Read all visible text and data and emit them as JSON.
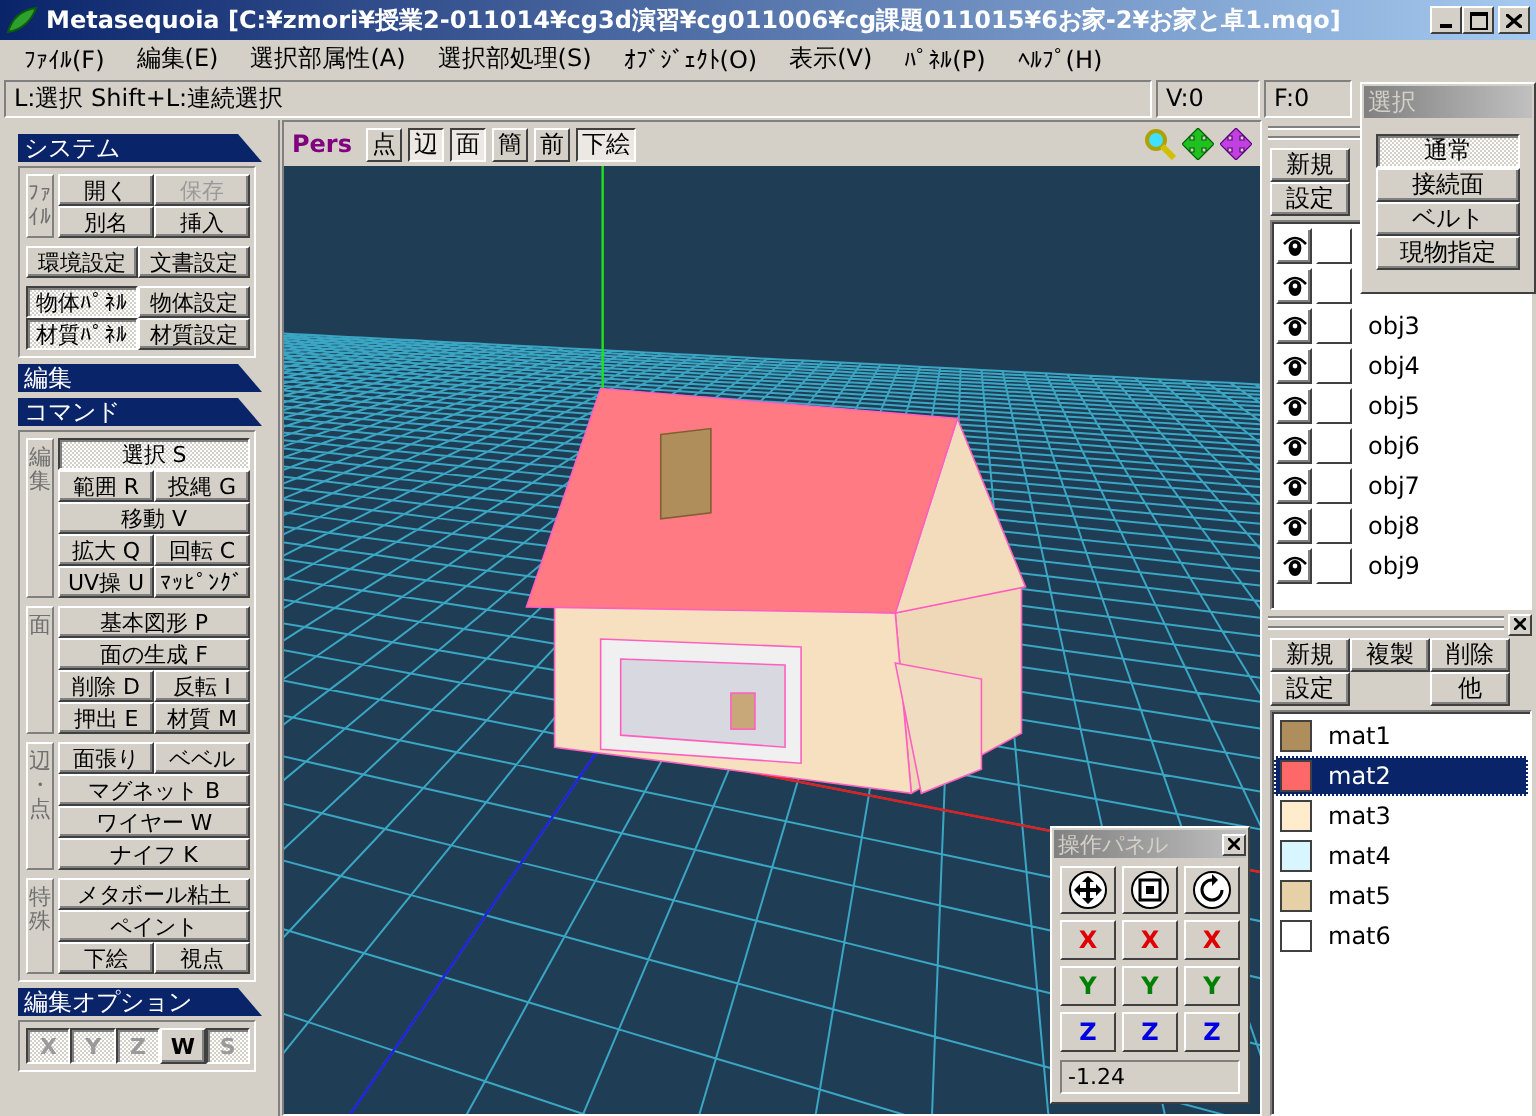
{
  "window": {
    "title": "Metasequoia [C:¥zmori¥授業2-011014¥cg3d演習¥cg011006¥cg課題011015¥6お家-2¥お家と卓1.mqo]"
  },
  "menu": [
    "ﾌｧｲﾙ(F)",
    "編集(E)",
    "選択部属性(A)",
    "選択部処理(S)",
    "ｵﾌﾞｼﾞｪｸﾄ(O)",
    "表示(V)",
    "ﾊﾟﾈﾙ(P)",
    "ﾍﾙﾌﾟ(H)"
  ],
  "status_bar": {
    "hint": "L:選択  Shift+L:連続選択",
    "vertices": "V:0",
    "faces": "F:0"
  },
  "left_panel": {
    "sections": [
      {
        "title": "システム",
        "groups": [
          {
            "side_label": "ﾌｧｲﾙ",
            "rows": [
              [
                {
                  "label": "開く",
                  "selected": false,
                  "disabled": false
                },
                {
                  "label": "保存",
                  "selected": false,
                  "disabled": true
                }
              ],
              [
                {
                  "label": "別名",
                  "selected": false,
                  "disabled": false
                },
                {
                  "label": "挿入",
                  "selected": false,
                  "disabled": false
                }
              ]
            ]
          },
          {
            "rows": [
              [
                {
                  "label": "環境設定",
                  "selected": false,
                  "disabled": false
                },
                {
                  "label": "文書設定",
                  "selected": false,
                  "disabled": false
                }
              ]
            ]
          },
          {
            "rows": [
              [
                {
                  "label": "物体ﾊﾟﾈﾙ",
                  "selected": true,
                  "disabled": false
                },
                {
                  "label": "物体設定",
                  "selected": false,
                  "disabled": false
                }
              ],
              [
                {
                  "label": "材質ﾊﾟﾈﾙ",
                  "selected": true,
                  "disabled": false
                },
                {
                  "label": "材質設定",
                  "selected": false,
                  "disabled": false
                }
              ]
            ]
          }
        ]
      },
      {
        "title": "編集"
      },
      {
        "title": "コマンド",
        "groups": [
          {
            "side_label": "編集",
            "rows": [
              [
                {
                  "label": "選択 S",
                  "selected": true,
                  "disabled": false
                }
              ],
              [
                {
                  "label": "範囲 R",
                  "selected": false,
                  "disabled": false
                },
                {
                  "label": "投縄 G",
                  "selected": false,
                  "disabled": false
                }
              ],
              [
                {
                  "label": "移動 V",
                  "selected": false,
                  "disabled": false
                }
              ],
              [
                {
                  "label": "拡大 Q",
                  "selected": false,
                  "disabled": false
                },
                {
                  "label": "回転 C",
                  "selected": false,
                  "disabled": false
                }
              ],
              [
                {
                  "label": "UV操 U",
                  "selected": false,
                  "disabled": false
                },
                {
                  "label": "ﾏｯﾋﾟﾝｸﾞ",
                  "selected": false,
                  "disabled": false
                }
              ]
            ]
          },
          {
            "side_label": "面",
            "rows": [
              [
                {
                  "label": "基本図形 P",
                  "selected": false,
                  "disabled": false
                }
              ],
              [
                {
                  "label": "面の生成 F",
                  "selected": false,
                  "disabled": false
                }
              ],
              [
                {
                  "label": "削除 D",
                  "selected": false,
                  "disabled": false
                },
                {
                  "label": "反転 I",
                  "selected": false,
                  "disabled": false
                }
              ],
              [
                {
                  "label": "押出 E",
                  "selected": false,
                  "disabled": false
                },
                {
                  "label": "材質 M",
                  "selected": false,
                  "disabled": false
                }
              ]
            ]
          },
          {
            "side_label": "辺・点",
            "rows": [
              [
                {
                  "label": "面張り",
                  "selected": false,
                  "disabled": false
                },
                {
                  "label": "ベベル",
                  "selected": false,
                  "disabled": false
                }
              ],
              [
                {
                  "label": "マグネット B",
                  "selected": false,
                  "disabled": false
                }
              ],
              [
                {
                  "label": "ワイヤー W",
                  "selected": false,
                  "disabled": false
                }
              ],
              [
                {
                  "label": "ナイフ K",
                  "selected": false,
                  "disabled": false
                }
              ]
            ]
          },
          {
            "side_label": "特殊",
            "rows": [
              [
                {
                  "label": "メタボール粘土",
                  "selected": false,
                  "disabled": false
                }
              ],
              [
                {
                  "label": "ペイント",
                  "selected": false,
                  "disabled": false
                }
              ],
              [
                {
                  "label": "下絵",
                  "selected": false,
                  "disabled": false
                },
                {
                  "label": "視点",
                  "selected": false,
                  "disabled": false
                }
              ]
            ]
          }
        ]
      },
      {
        "title": "編集オプション",
        "groups": [
          {
            "rows": [
              [
                {
                  "label": "X",
                  "selected": true,
                  "disabled": true
                },
                {
                  "label": "Y",
                  "selected": true,
                  "disabled": true
                },
                {
                  "label": "Z",
                  "selected": true,
                  "disabled": true
                },
                {
                  "label": "W",
                  "selected": false,
                  "disabled": false
                },
                {
                  "label": "S",
                  "selected": true,
                  "disabled": true
                }
              ]
            ]
          }
        ]
      }
    ]
  },
  "viewport": {
    "view_label": "Pers",
    "toggles": [
      {
        "label": "点",
        "selected": false
      },
      {
        "label": "辺",
        "selected": true
      },
      {
        "label": "面",
        "selected": true
      },
      {
        "label": "簡",
        "selected": false
      },
      {
        "label": "前",
        "selected": false
      },
      {
        "label": "下絵",
        "selected": true
      }
    ]
  },
  "operation_panel": {
    "title": "操作パネル",
    "rows": [
      {
        "labels": [
          "X",
          "X",
          "X"
        ],
        "color": "#e00000"
      },
      {
        "labels": [
          "Y",
          "Y",
          "Y"
        ],
        "color": "#008000"
      },
      {
        "labels": [
          "Z",
          "Z",
          "Z"
        ],
        "color": "#0000e0"
      }
    ],
    "value": "-1.24"
  },
  "selection_panel": {
    "title": "選択",
    "options": [
      {
        "label": "通常",
        "selected": true
      },
      {
        "label": "接続面",
        "selected": false
      },
      {
        "label": "ベルト",
        "selected": false
      },
      {
        "label": "現物指定",
        "selected": false
      }
    ]
  },
  "object_panel": {
    "buttons": [
      "新規",
      "設定"
    ],
    "objects": [
      {
        "visible": true
      },
      {
        "visible": true
      },
      {
        "name": "obj3",
        "visible": true
      },
      {
        "name": "obj4",
        "visible": true
      },
      {
        "name": "obj5",
        "visible": true
      },
      {
        "name": "obj6",
        "visible": true
      },
      {
        "name": "obj7",
        "visible": true
      },
      {
        "name": "obj8",
        "visible": true
      },
      {
        "name": "obj9",
        "visible": true
      }
    ]
  },
  "material_panel": {
    "buttons": [
      [
        "新規",
        "複製",
        "削除"
      ],
      [
        "設定",
        "他"
      ]
    ],
    "materials": [
      {
        "name": "mat1",
        "color": "#b08e5c",
        "selected": false
      },
      {
        "name": "mat2",
        "color": "#ff6868",
        "selected": true
      },
      {
        "name": "mat3",
        "color": "#ffeccc",
        "selected": false
      },
      {
        "name": "mat4",
        "color": "#d8f6ff",
        "selected": false
      },
      {
        "name": "mat5",
        "color": "#e6d0a8",
        "selected": false
      },
      {
        "name": "mat6",
        "color": "#ffffff",
        "selected": false
      }
    ]
  }
}
